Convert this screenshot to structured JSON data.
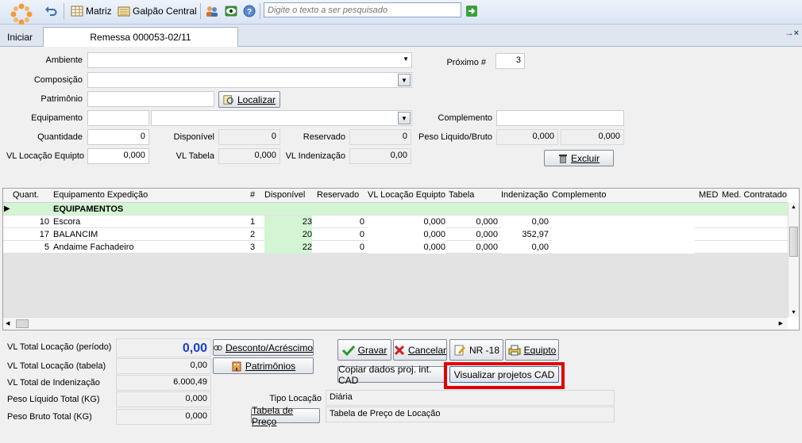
{
  "toolbar": {
    "matriz_label": "Matriz",
    "galpao_label": "Galpão Central",
    "search_placeholder": "Digite o texto a ser pesquisado"
  },
  "tabs": {
    "iniciar": "Iniciar",
    "remessa": "Remessa 000053-02/11",
    "close": "→×"
  },
  "form": {
    "ambiente_label": "Ambiente",
    "composicao_label": "Composição",
    "patrimonio_label": "Patrimônio",
    "localizar_label": "Localizar",
    "equipamento_label": "Equipamento",
    "quantidade_label": "Quantidade",
    "quantidade_value": "0",
    "disponivel_label": "Disponível",
    "disponivel_value": "0",
    "reservado_label": "Reservado",
    "reservado_value": "0",
    "vl_locacao_label": "VL Locação Equipto",
    "vl_locacao_value": "0,000",
    "vl_tabela_label": "VL Tabela",
    "vl_tabela_value": "0,000",
    "vl_indenizacao_label": "VL Indenização",
    "vl_indenizacao_value": "0,00",
    "proximo_label": "Próximo #",
    "proximo_value": "3",
    "complemento_label": "Complemento",
    "peso_label": "Peso Liquido/Bruto",
    "peso_liquido": "0,000",
    "peso_bruto": "0,000",
    "excluir_label": "Excluir"
  },
  "grid": {
    "headers": [
      "Quant.",
      "Equipamento Expedição",
      "#",
      "Disponível",
      "Reservado",
      "VL Locação Equipto",
      "Tabela",
      "Indenização",
      "Complemento",
      "MED",
      "Med. Contratado"
    ],
    "group": "EQUIPAMENTOS",
    "rows": [
      {
        "quant": "10",
        "equip": "Escora",
        "num": "1",
        "disp": "23",
        "res": "0",
        "vl": "0,000",
        "tab": "0,000",
        "ind": "0,00"
      },
      {
        "quant": "17",
        "equip": "BALANCIM",
        "num": "2",
        "disp": "20",
        "res": "0",
        "vl": "0,000",
        "tab": "0,000",
        "ind": "352,97"
      },
      {
        "quant": "5",
        "equip": "Andaime Fachadeiro",
        "num": "3",
        "disp": "22",
        "res": "0",
        "vl": "0,000",
        "tab": "0,000",
        "ind": "0,00"
      }
    ]
  },
  "totals": {
    "vl_total_periodo_label": "VL Total Locação (período)",
    "vl_total_periodo": "0,00",
    "vl_total_tabela_label": "VL Total Locação (tabela)",
    "vl_total_tabela": "0,00",
    "vl_total_ind_label": "VL Total de Indenização",
    "vl_total_ind": "6.000,49",
    "peso_liq_label": "Peso Líquido Total (KG)",
    "peso_liq": "0,000",
    "peso_bruto_label": "Peso Bruto Total (KG)",
    "peso_bruto": "0,000"
  },
  "actions": {
    "desconto": "Desconto/Acréscimo",
    "patrimonios": "Patrimônios",
    "gravar": "Gravar",
    "cancelar": "Cancelar",
    "nr18": "NR -18",
    "equipto": "Equipto",
    "copiar": "Copiar dados proj. int. CAD",
    "visualizar": "Visualizar projetos CAD",
    "tipo_locacao_label": "Tipo Locação",
    "tipo_locacao": "Diária",
    "tabela_preco_btn": "Tabela de Preço",
    "tabela_preco": "Tabela de Preço de Locação"
  }
}
